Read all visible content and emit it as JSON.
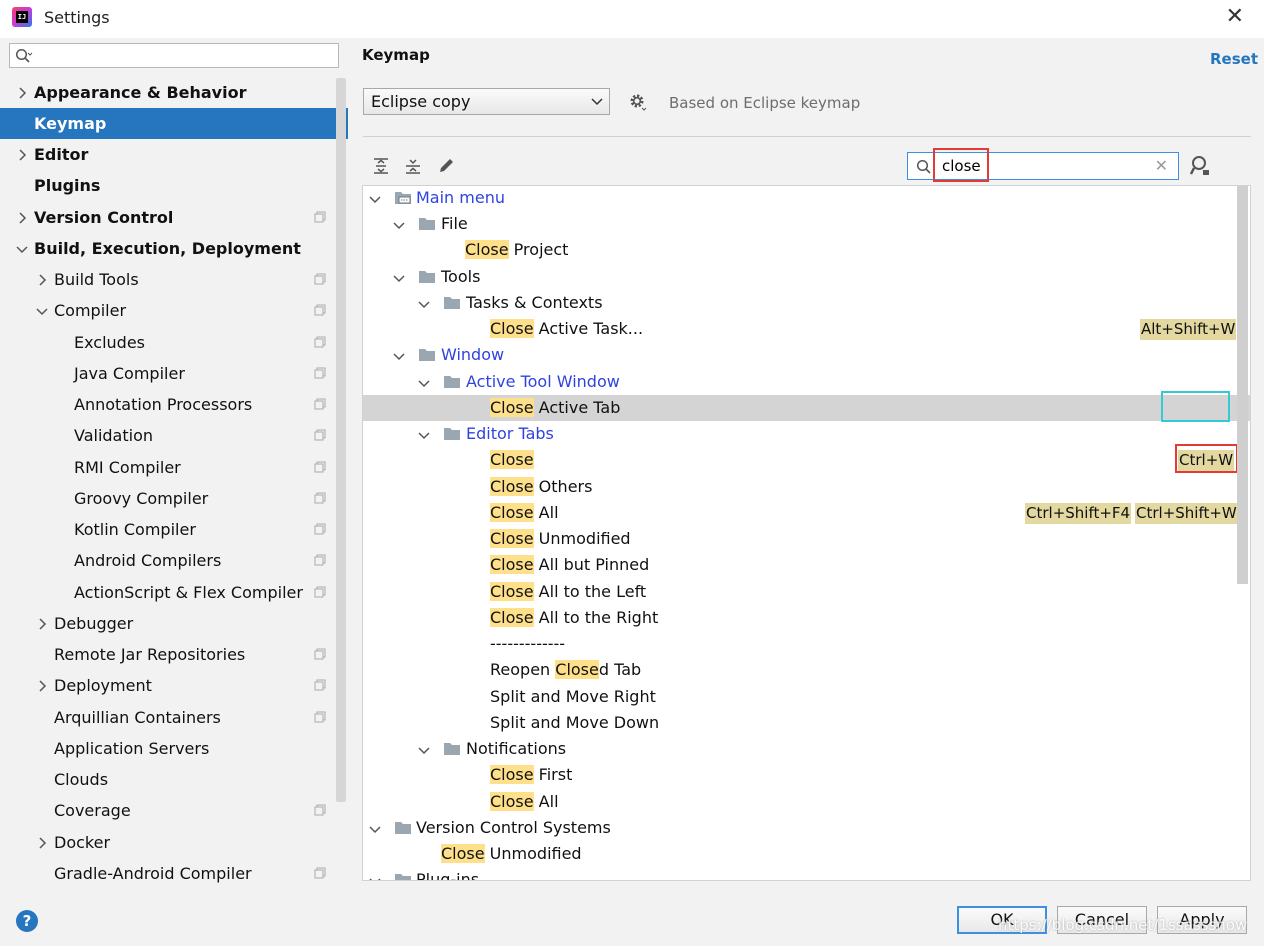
{
  "window": {
    "title": "Settings",
    "close_glyph": "✕"
  },
  "sidebar": {
    "search_placeholder": "",
    "items": [
      {
        "label": "Appearance & Behavior"
      },
      {
        "label": "Keymap"
      },
      {
        "label": "Editor"
      },
      {
        "label": "Plugins"
      },
      {
        "label": "Version Control"
      },
      {
        "label": "Build, Execution, Deployment"
      },
      {
        "label": "Build Tools"
      },
      {
        "label": "Compiler"
      },
      {
        "label": "Excludes"
      },
      {
        "label": "Java Compiler"
      },
      {
        "label": "Annotation Processors"
      },
      {
        "label": "Validation"
      },
      {
        "label": "RMI Compiler"
      },
      {
        "label": "Groovy Compiler"
      },
      {
        "label": "Kotlin Compiler"
      },
      {
        "label": "Android Compilers"
      },
      {
        "label": "ActionScript & Flex Compiler"
      },
      {
        "label": "Debugger"
      },
      {
        "label": "Remote Jar Repositories"
      },
      {
        "label": "Deployment"
      },
      {
        "label": "Arquillian Containers"
      },
      {
        "label": "Application Servers"
      },
      {
        "label": "Clouds"
      },
      {
        "label": "Coverage"
      },
      {
        "label": "Docker"
      },
      {
        "label": "Gradle-Android Compiler"
      }
    ]
  },
  "main": {
    "title": "Keymap",
    "reset_label": "Reset",
    "keymap_selected": "Eclipse copy",
    "based_on": "Based on Eclipse keymap",
    "search_value": "close",
    "clear_glyph": "✕"
  },
  "tree": {
    "rows": [
      {
        "pre": "",
        "hl": "",
        "post": "Main menu"
      },
      {
        "pre": "",
        "hl": "",
        "post": "File"
      },
      {
        "pre": "",
        "hl": "Close",
        "post": " Project"
      },
      {
        "pre": "",
        "hl": "",
        "post": "Tools"
      },
      {
        "pre": "",
        "hl": "",
        "post": "Tasks & Contexts"
      },
      {
        "pre": "",
        "hl": "Close",
        "post": " Active Task..."
      },
      {
        "pre": "",
        "hl": "",
        "post": "Window"
      },
      {
        "pre": "",
        "hl": "",
        "post": "Active Tool Window"
      },
      {
        "pre": "",
        "hl": "Close",
        "post": " Active Tab"
      },
      {
        "pre": "",
        "hl": "",
        "post": "Editor Tabs"
      },
      {
        "pre": "",
        "hl": "Close",
        "post": ""
      },
      {
        "pre": "",
        "hl": "Close",
        "post": " Others"
      },
      {
        "pre": "",
        "hl": "Close",
        "post": " All"
      },
      {
        "pre": "",
        "hl": "Close",
        "post": " Unmodified"
      },
      {
        "pre": "",
        "hl": "Close",
        "post": " All but Pinned"
      },
      {
        "pre": "",
        "hl": "Close",
        "post": " All to the Left"
      },
      {
        "pre": "",
        "hl": "Close",
        "post": " All to the Right"
      },
      {
        "pre": "",
        "hl": "",
        "post": "-------------"
      },
      {
        "pre": "Reopen ",
        "hl": "Close",
        "post": "d Tab"
      },
      {
        "pre": "",
        "hl": "",
        "post": "Split and Move Right"
      },
      {
        "pre": "",
        "hl": "",
        "post": "Split and Move Down"
      },
      {
        "pre": "",
        "hl": "",
        "post": "Notifications"
      },
      {
        "pre": "",
        "hl": "Close",
        "post": " First"
      },
      {
        "pre": "",
        "hl": "Close",
        "post": " All"
      },
      {
        "pre": "",
        "hl": "",
        "post": "Version Control Systems"
      },
      {
        "pre": "",
        "hl": "Close",
        "post": " Unmodified"
      },
      {
        "pre": "",
        "hl": "",
        "post": "Plug-ins"
      }
    ],
    "shortcuts": {
      "close_active_task": "Alt+Shift+W",
      "close": "Ctrl+W",
      "close_all_1": "Ctrl+Shift+F4",
      "close_all_2": "Ctrl+Shift+W"
    }
  },
  "footer": {
    "help_label": "?",
    "ok_label": "OK",
    "cancel_label": "Cancel",
    "apply_label": "Apply",
    "watermark": "https://blog.csdn.net/1ssasssnow"
  },
  "colors": {
    "accent": "#2675bf",
    "highlight": "#ffe08a",
    "shortcut_bg": "#e3d8a0",
    "link_blue": "#2f43e0"
  }
}
